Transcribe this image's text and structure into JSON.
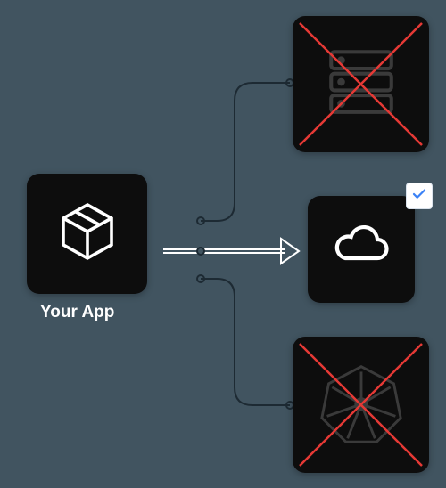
{
  "source": {
    "label": "Your App",
    "icon": "package-icon"
  },
  "targets": {
    "top": {
      "icon": "server-icon",
      "crossed_out": true,
      "cross_color": "#e53935"
    },
    "middle": {
      "icon": "cloud-icon",
      "crossed_out": false,
      "selected": true
    },
    "bottom": {
      "icon": "kubernetes-icon",
      "crossed_out": true,
      "cross_color": "#e53935"
    }
  },
  "check_color": "#3b82f6",
  "connector_color": "#1d2a33",
  "arrow_color": "#ffffff"
}
